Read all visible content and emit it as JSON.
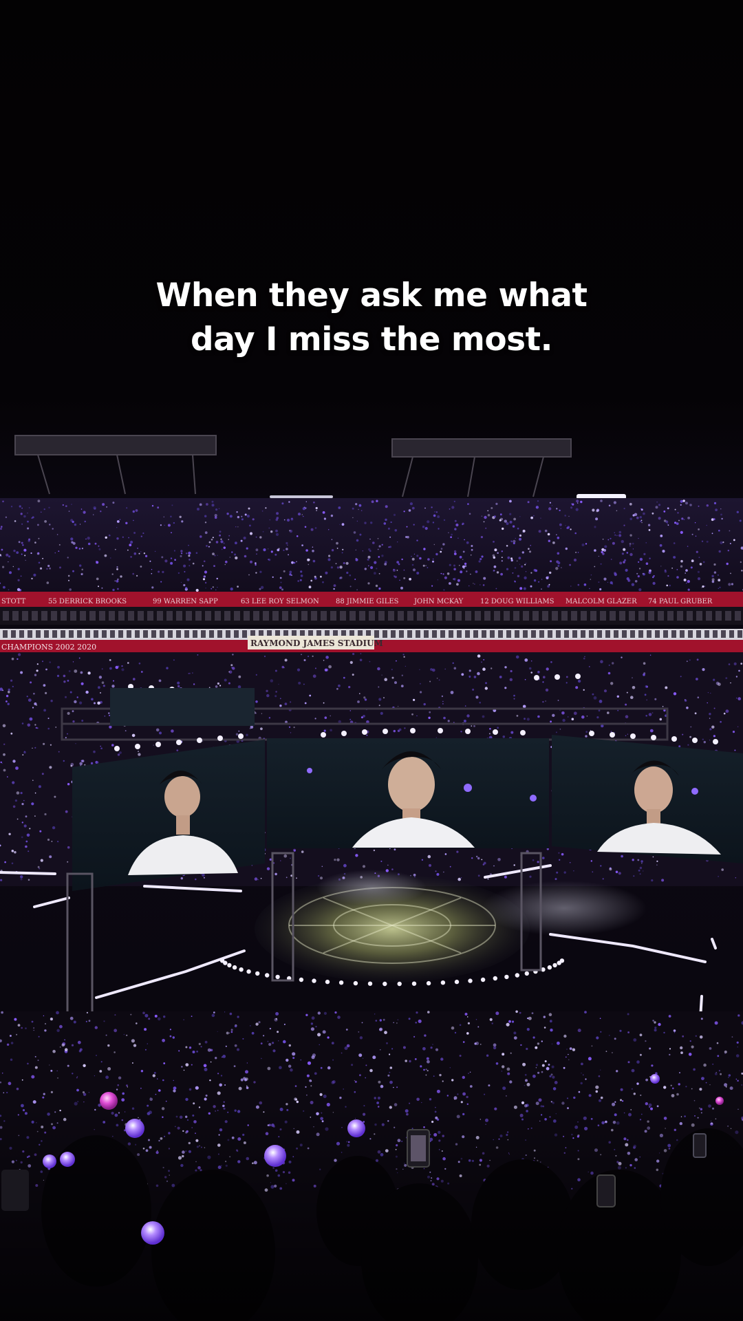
{
  "caption": {
    "line1": "When they ask me what",
    "line2": "day I miss the most."
  },
  "stadium": {
    "ring_of_honor": [
      "STOTT",
      "55 DERRICK BROOKS",
      "99 WARREN SAPP",
      "63 LEE ROY SELMON",
      "88 JIMMIE GILES",
      "JOHN MCKAY",
      "12 DOUG WILLIAMS",
      "MALCOLM GLAZER",
      "74 PAUL GRUBER"
    ],
    "championships": "CHAMPIONS  2002  2020",
    "sponsor_sign": "RAYMOND JAMES STADIUM"
  },
  "colors": {
    "lightstick_purple": "#8a5cff",
    "banner_red": "#a1122c",
    "stage_light": "#f4f0ff"
  }
}
